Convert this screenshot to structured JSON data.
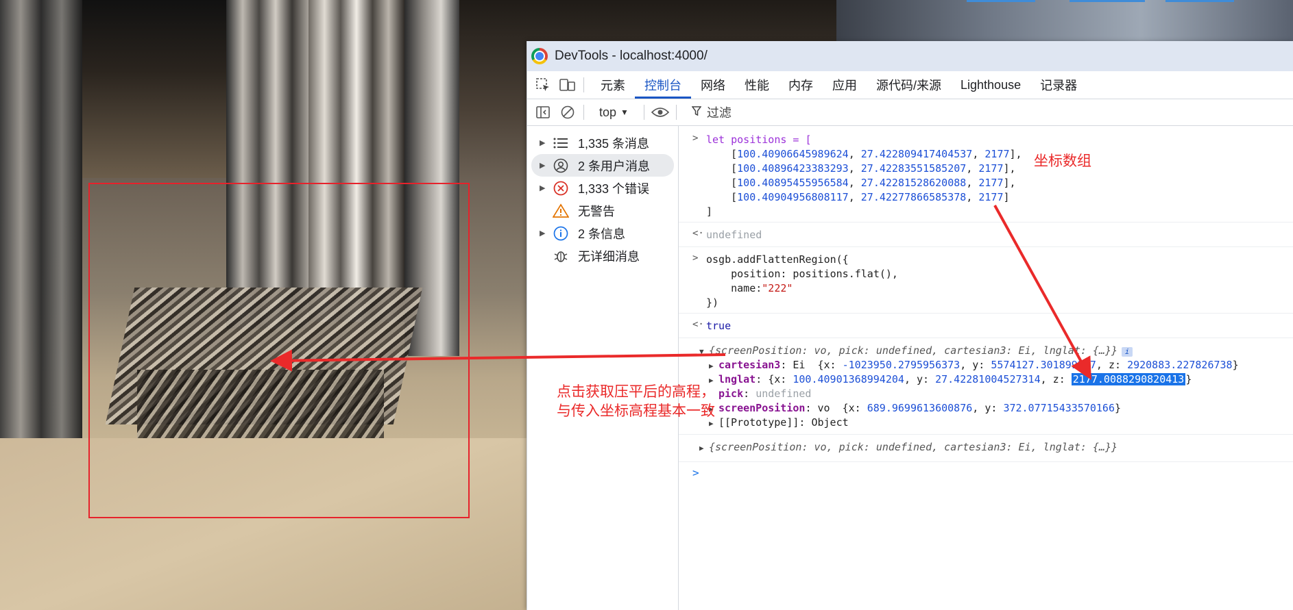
{
  "window": {
    "title": "DevTools - localhost:4000/"
  },
  "tabs": [
    {
      "label": "元素"
    },
    {
      "label": "控制台"
    },
    {
      "label": "网络"
    },
    {
      "label": "性能"
    },
    {
      "label": "内存"
    },
    {
      "label": "应用"
    },
    {
      "label": "源代码/来源"
    },
    {
      "label": "Lighthouse"
    },
    {
      "label": "记录器"
    }
  ],
  "active_tab": "控制台",
  "toolbar": {
    "context": "top",
    "filter_label": "过滤"
  },
  "sidebar": {
    "items": [
      {
        "label": "1,335 条消息",
        "icon": "list-icon"
      },
      {
        "label": "2 条用户消息",
        "icon": "user-icon"
      },
      {
        "label": "1,333 个错误",
        "icon": "error-icon"
      },
      {
        "label": "无警告",
        "icon": "warning-icon"
      },
      {
        "label": "2 条信息",
        "icon": "info-icon"
      },
      {
        "label": "无详细消息",
        "icon": "bug-icon"
      }
    ]
  },
  "console": {
    "positions_decl": "let positions = [",
    "positions": [
      [
        "100.40906645989624",
        "27.422809417404537",
        "2177"
      ],
      [
        "100.40896423383293",
        "27.42283551585207",
        "2177"
      ],
      [
        "100.40895455956584",
        "27.42281528620088",
        "2177"
      ],
      [
        "100.40904956808117",
        "27.42277866585378",
        "2177"
      ]
    ],
    "close_bracket": "]",
    "undefined": "undefined",
    "call_line1": "osgb.addFlattenRegion({",
    "call_line2": "    position: positions.flat(),",
    "call_name_key": "    name:",
    "call_name_val": "\"222\"",
    "call_end": "})",
    "result_true": "true",
    "obj_summary": "{screenPosition: vo, pick: undefined, cartesian3: Ei, lnglat: {…}}",
    "cartesian3_key": "cartesian3",
    "cartesian3_type": "Ei",
    "cartesian3_x": "-1023950.2795956373",
    "cartesian3_y": "5574127.301899267",
    "cartesian3_z": "2920883.227826738",
    "lnglat_key": "lnglat",
    "lnglat_x": "100.40901368994204",
    "lnglat_y": "27.42281004527314",
    "lnglat_z": "2177.0088290820413",
    "pick_key": "pick",
    "pick_val": "undefined",
    "screen_key": "screenPosition",
    "screen_type": "vo",
    "screen_x": "689.9699613600876",
    "screen_y": "372.07715433570166",
    "proto": "[[Prototype]]: Object",
    "obj_summary2": "{screenPosition: vo, pick: undefined, cartesian3: Ei, lnglat: {…}}"
  },
  "annotations": {
    "coords_label": "坐标数组",
    "click_line1": "点击获取压平后的高程，",
    "click_line2": "与传入坐标高程基本一致"
  },
  "colors": {
    "annotation": "#ea2a2a",
    "accent": "#1a56c4"
  }
}
